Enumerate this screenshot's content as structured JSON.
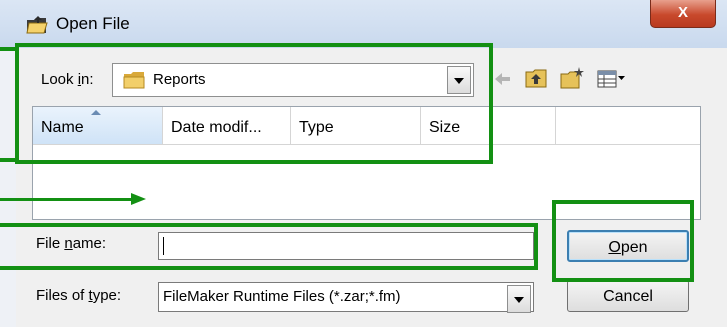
{
  "window": {
    "title": "Open File",
    "close_symbol": "X"
  },
  "look_in": {
    "label_pre": "Look ",
    "label_accel": "i",
    "label_post": "n:",
    "value": "Reports"
  },
  "listview": {
    "columns": [
      "Name",
      "Date modif...",
      "Type",
      "Size"
    ]
  },
  "file_name": {
    "label_pre": "File ",
    "label_accel": "n",
    "label_post": "ame:",
    "value": ""
  },
  "file_type": {
    "label_pre": "Files of ",
    "label_accel": "t",
    "label_post": "ype:",
    "value": "FileMaker Runtime Files (*.zar;*.fm)"
  },
  "buttons": {
    "open": "Open",
    "open_accel": "O",
    "open_rest": "pen",
    "cancel": "Cancel"
  },
  "colors": {
    "annotation": "#139013",
    "titlebar": "#c9d9ee",
    "close": "#c8492c"
  }
}
